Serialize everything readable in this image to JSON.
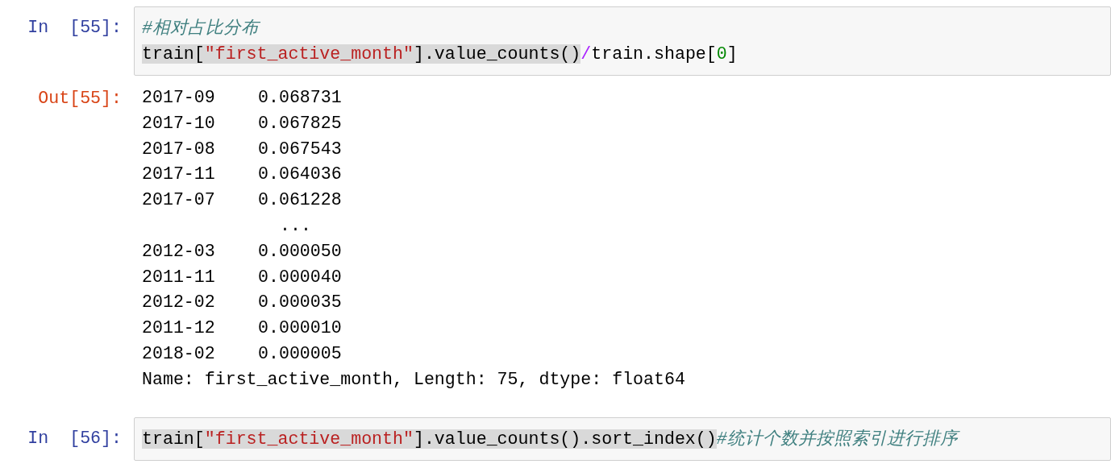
{
  "cells": [
    {
      "prompt": "In  [55]:",
      "input_lines": [
        [
          {
            "text": "#相对占比分布",
            "kind": "comment",
            "highlighted": false
          }
        ],
        [
          {
            "text": "train[",
            "kind": "plain",
            "highlighted": true
          },
          {
            "text": "\"first_active_month\"",
            "kind": "string",
            "highlighted": true
          },
          {
            "text": "].value_counts()",
            "kind": "plain",
            "highlighted": true
          },
          {
            "text": "/",
            "kind": "operator",
            "highlighted": false
          },
          {
            "text": "train.shape[",
            "kind": "plain",
            "highlighted": false
          },
          {
            "text": "0",
            "kind": "number",
            "highlighted": false
          },
          {
            "text": "]",
            "kind": "plain",
            "highlighted": false
          }
        ]
      ],
      "output": {
        "prompt": "Out[55]:",
        "rows": [
          {
            "index": "2017-09",
            "value": "0.068731"
          },
          {
            "index": "2017-10",
            "value": "0.067825"
          },
          {
            "index": "2017-08",
            "value": "0.067543"
          },
          {
            "index": "2017-11",
            "value": "0.064036"
          },
          {
            "index": "2017-07",
            "value": "0.061228"
          },
          {
            "value": "..."
          },
          {
            "index": "2012-03",
            "value": "0.000050"
          },
          {
            "index": "2011-11",
            "value": "0.000040"
          },
          {
            "index": "2012-02",
            "value": "0.000035"
          },
          {
            "index": "2011-12",
            "value": "0.000010"
          },
          {
            "index": "2018-02",
            "value": "0.000005"
          }
        ],
        "footer": "Name: first_active_month, Length: 75, dtype: float64"
      }
    },
    {
      "prompt": "In  [56]:",
      "input_lines": [
        [
          {
            "text": "train[",
            "kind": "plain",
            "highlighted": true
          },
          {
            "text": "\"first_active_month\"",
            "kind": "string",
            "highlighted": true
          },
          {
            "text": "].value_counts().sort_index()",
            "kind": "plain",
            "highlighted": true
          },
          {
            "text": "#统计个数并按照索引进行排序",
            "kind": "comment",
            "highlighted": false
          }
        ]
      ]
    }
  ]
}
